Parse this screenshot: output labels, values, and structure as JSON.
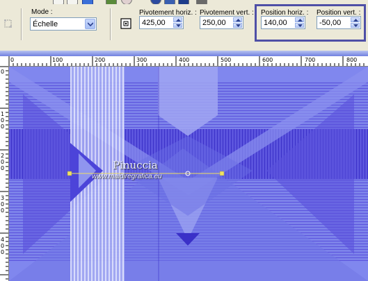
{
  "toolbar": {
    "mode_label": "Mode :",
    "mode_value": "Échelle",
    "pivot_h_label": "Pivotement horiz. :",
    "pivot_h_value": "425,00",
    "pivot_v_label": "Pivotement vert. :",
    "pivot_v_value": "250,00",
    "pos_h_label": "Position horiz. :",
    "pos_h_value": "140,00",
    "pos_v_label": "Position vert. :",
    "pos_v_value": "-50,00"
  },
  "ruler": {
    "top": [
      "0",
      "100",
      "200",
      "300",
      "400",
      "500",
      "600",
      "700",
      "800"
    ],
    "left": [
      "0",
      "1\n0\n0",
      "2\n0\n0",
      "3\n0\n0",
      "4\n0\n0"
    ]
  },
  "canvas": {
    "watermark_title": "Pinuccia",
    "watermark_url": "www.maidiregrafica.eu"
  },
  "colors": {
    "canvas_dark": "#4c44d9",
    "canvas_light": "#8f95ef",
    "highlight_box": "#4e4fa6",
    "handle": "#f0e060"
  }
}
